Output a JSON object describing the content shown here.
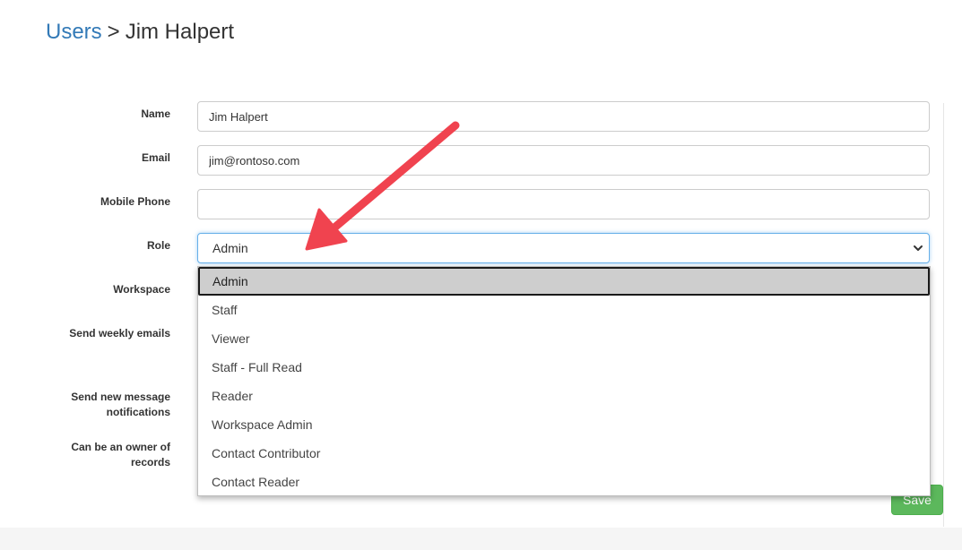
{
  "breadcrumb": {
    "parent": "Users",
    "separator": ">",
    "current": "Jim Halpert"
  },
  "form": {
    "name_label": "Name",
    "name_value": "Jim Halpert",
    "email_label": "Email",
    "email_value": "jim@rontoso.com",
    "mobile_label": "Mobile Phone",
    "mobile_value": "",
    "role_label": "Role",
    "role_value": "Admin",
    "workspace_label": "Workspace",
    "weekly_emails_label": "Send weekly emails",
    "notifications_label_line1": "Send new message",
    "notifications_label_line2": "notifications",
    "owner_label_line1": "Can be an owner of",
    "owner_label_line2": "records",
    "save_label": "Save"
  },
  "role_dropdown": {
    "options": [
      "Admin",
      "Staff",
      "Viewer",
      "Staff - Full Read",
      "Reader",
      "Workspace Admin",
      "Contact Contributor",
      "Contact Reader"
    ],
    "selected_index": 0
  },
  "colors": {
    "link": "#337ab7",
    "save_button": "#5cb85c",
    "annotation_arrow": "#f0434f",
    "selected_option_bg": "#cecece"
  },
  "icons": {
    "select_chevron": "chevron-down-icon",
    "annotation": "arrow-annotation-icon"
  }
}
